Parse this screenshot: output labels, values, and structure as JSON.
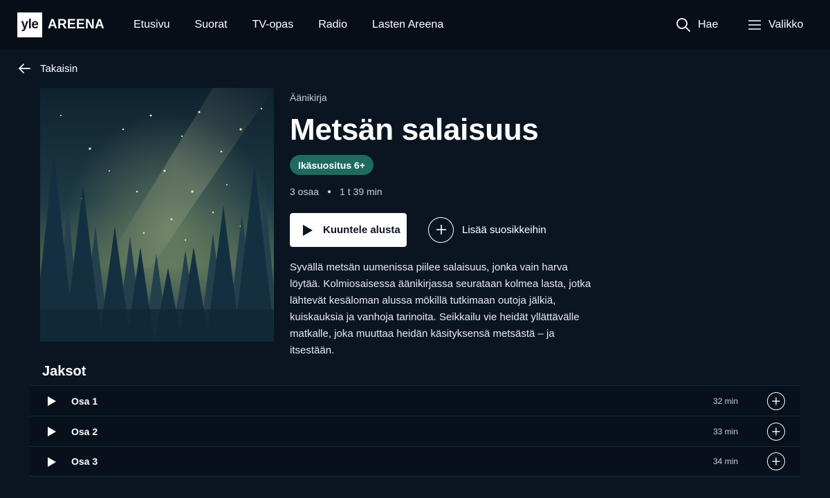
{
  "header": {
    "logo_mark": "yle",
    "logo_text": "AREENA",
    "nav": [
      "Etusivu",
      "Suorat",
      "TV-opas",
      "Radio",
      "Lasten Areena"
    ],
    "search_label": "Hae",
    "menu_label": "Valikko"
  },
  "back_label": "Takaisin",
  "program": {
    "category": "Äänikirja",
    "title": "Metsän salaisuus",
    "age_rating": "Ikäsuositus 6+",
    "episode_count": "3 osaa",
    "total_duration": "1 t 39 min",
    "play_label": "Kuuntele alusta",
    "favorite_label": "Lisää suosikkeihin",
    "description": "Syvällä metsän uumenissa piilee salaisuus, jonka vain harva löytää. Kolmiosaisessa äänikirjassa seurataan kolmea lasta, jotka lähtevät kesäloman alussa mökillä tutkimaan outoja jälkiä, kuiskauksia ja vanhoja tarinoita. Seikkailu vie heidät yllättävälle matkalle, joka muuttaa heidän käsityksensä metsästä – ja itsestään."
  },
  "episodes_section": {
    "title": "Jaksot",
    "items": [
      {
        "title": "Osa 1",
        "duration": "32 min"
      },
      {
        "title": "Osa 2",
        "duration": "33 min"
      },
      {
        "title": "Osa 3",
        "duration": "34 min"
      }
    ]
  },
  "colors": {
    "background": "#0b1421",
    "header": "#070e18",
    "badge": "#1f6a5f",
    "text_muted": "#c7ced8"
  }
}
